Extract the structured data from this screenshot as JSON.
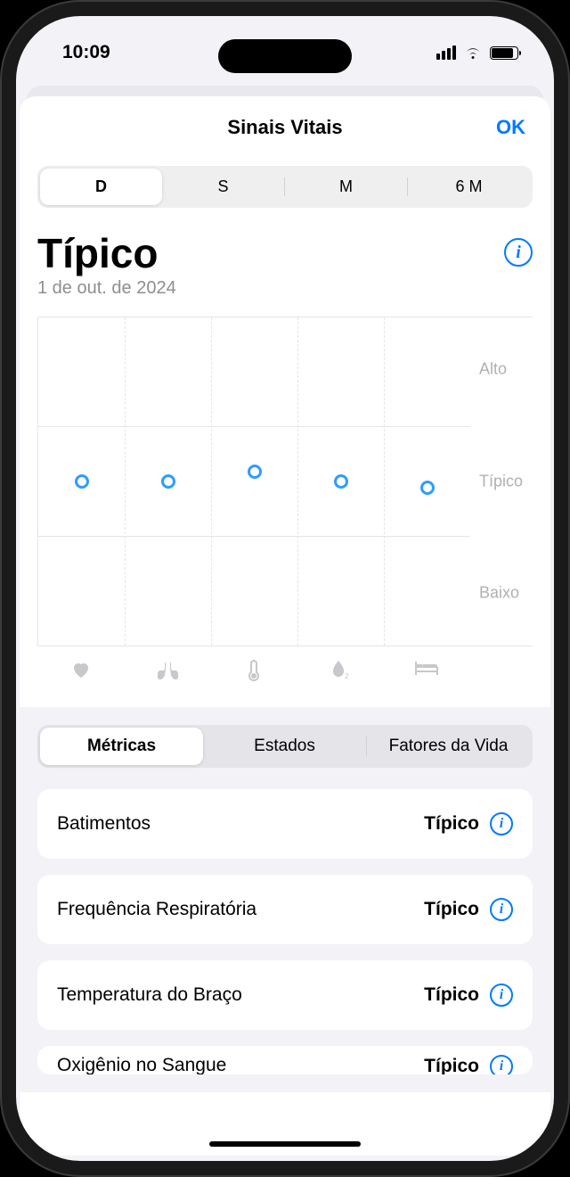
{
  "status": {
    "time": "10:09"
  },
  "sheet": {
    "title": "Sinais Vitais",
    "ok": "OK"
  },
  "range_tabs": [
    "D",
    "S",
    "M",
    "6 M"
  ],
  "heading": {
    "title": "Típico",
    "date": "1 de out. de 2024"
  },
  "chart_data": {
    "type": "scatter",
    "categories": [
      "heart",
      "lungs",
      "thermometer",
      "oxygen",
      "bed"
    ],
    "values": [
      50,
      50,
      53,
      50,
      48
    ],
    "y_levels": {
      "alto": "Alto",
      "tipico": "Típico",
      "baixo": "Baixo"
    },
    "ylim": [
      0,
      100
    ],
    "title": "",
    "xlabel": "",
    "ylabel": ""
  },
  "section_tabs": [
    "Métricas",
    "Estados",
    "Fatores da Vida"
  ],
  "metrics": [
    {
      "name": "Batimentos",
      "status": "Típico"
    },
    {
      "name": "Frequência Respiratória",
      "status": "Típico"
    },
    {
      "name": "Temperatura do Braço",
      "status": "Típico"
    },
    {
      "name": "Oxigênio no Sangue",
      "status": "Típico"
    }
  ],
  "colors": {
    "accent": "#007aff",
    "point": "#2e9cff"
  }
}
